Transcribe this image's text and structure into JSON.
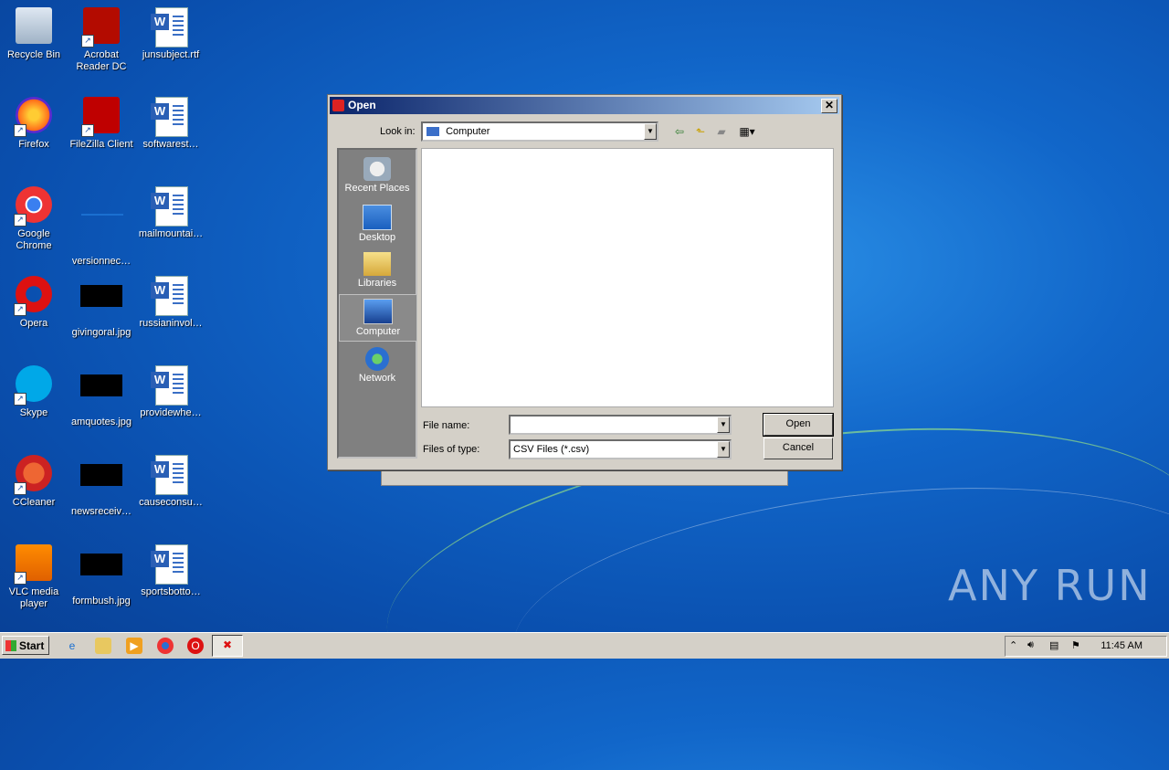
{
  "desktop": {
    "icons": [
      {
        "label": "Recycle Bin",
        "icon": "recycle-bin-icon"
      },
      {
        "label": "Acrobat Reader DC",
        "icon": "acrobat-icon"
      },
      {
        "label": "junsubject.rtf",
        "icon": "word-doc-icon"
      },
      {
        "label": "Firefox",
        "icon": "firefox-icon"
      },
      {
        "label": "FileZilla Client",
        "icon": "filezilla-icon"
      },
      {
        "label": "softwarest…",
        "icon": "word-doc-icon"
      },
      {
        "label": "Google Chrome",
        "icon": "chrome-icon"
      },
      {
        "label": "versionnec…",
        "icon": "file-icon"
      },
      {
        "label": "mailmountai…",
        "icon": "word-doc-icon"
      },
      {
        "label": "Opera",
        "icon": "opera-icon"
      },
      {
        "label": "givingoral.jpg",
        "icon": "jpg-thumbnail-icon"
      },
      {
        "label": "russianinvol…",
        "icon": "word-doc-icon"
      },
      {
        "label": "Skype",
        "icon": "skype-icon"
      },
      {
        "label": "amquotes.jpg",
        "icon": "jpg-thumbnail-icon"
      },
      {
        "label": "providewhe…",
        "icon": "word-doc-icon"
      },
      {
        "label": "CCleaner",
        "icon": "ccleaner-icon"
      },
      {
        "label": "newsreceiv…",
        "icon": "jpg-thumbnail-icon"
      },
      {
        "label": "causeconsu…",
        "icon": "word-doc-icon"
      },
      {
        "label": "VLC media player",
        "icon": "vlc-icon"
      },
      {
        "label": "formbush.jpg",
        "icon": "jpg-thumbnail-icon"
      },
      {
        "label": "sportsbotto…",
        "icon": "word-doc-icon"
      }
    ]
  },
  "dialog": {
    "title": "Open",
    "look_in_label": "Look in:",
    "look_in_value": "Computer",
    "places": [
      {
        "label": "Recent Places"
      },
      {
        "label": "Desktop"
      },
      {
        "label": "Libraries"
      },
      {
        "label": "Computer"
      },
      {
        "label": "Network"
      }
    ],
    "file_name_label": "File name:",
    "file_name_value": "",
    "files_of_type_label": "Files of type:",
    "files_of_type_value": "CSV Files (*.csv)",
    "open_label": "Open",
    "cancel_label": "Cancel"
  },
  "taskbar": {
    "start_label": "Start",
    "clock": "11:45 AM"
  },
  "watermark": "ANY RUN"
}
